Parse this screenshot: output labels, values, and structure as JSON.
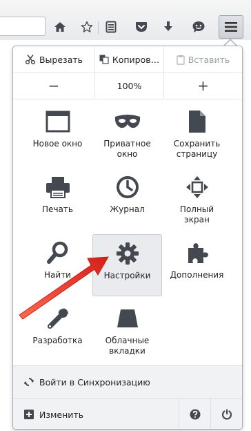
{
  "colors": {
    "icon": "#444850",
    "accent_arrow": "#e8322a",
    "highlight_bg": "#e9ebee"
  },
  "toolbar": {
    "icons": [
      "home-icon",
      "bookmark-star-icon",
      "reading-list-icon",
      "pocket-icon",
      "download-icon",
      "hello-chat-icon",
      "hamburger-menu-icon"
    ]
  },
  "edit": {
    "cut_label": "Вырезать",
    "copy_label": "Копиров…",
    "paste_label": "Вставить"
  },
  "zoom": {
    "minus_label": "−",
    "level": "100%",
    "plus_label": "+"
  },
  "grid": {
    "items": [
      {
        "label": "Новое окно",
        "icon": "new-window-icon"
      },
      {
        "label": "Приватное окно",
        "icon": "private-mask-icon"
      },
      {
        "label": "Сохранить страницу",
        "icon": "save-page-icon"
      },
      {
        "label": "Печать",
        "icon": "printer-icon"
      },
      {
        "label": "Журнал",
        "icon": "history-clock-icon"
      },
      {
        "label": "Полный экран",
        "icon": "fullscreen-icon"
      },
      {
        "label": "Найти",
        "icon": "find-magnifier-icon"
      },
      {
        "label": "Настройки",
        "icon": "settings-gear-icon"
      },
      {
        "label": "Дополнения",
        "icon": "addons-puzzle-icon"
      },
      {
        "label": "Разработка",
        "icon": "developer-wrench-icon"
      },
      {
        "label": "Облачные вкладки",
        "icon": "synced-tabs-icon"
      }
    ]
  },
  "footer": {
    "sync_label": "Войти в Синхронизацию",
    "customize_label": "Изменить"
  }
}
